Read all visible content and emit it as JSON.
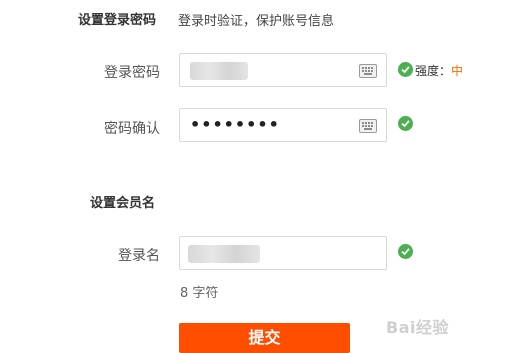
{
  "password_section": {
    "title": "设置登录密码",
    "hint": "登录时验证，保护账号信息"
  },
  "fields": {
    "password": {
      "label": "登录密码",
      "value": "",
      "strength_label": "强度：",
      "strength_value": "中"
    },
    "confirm": {
      "label": "密码确认",
      "value": "••••••••"
    }
  },
  "member_section": {
    "title": "设置会员名"
  },
  "username": {
    "label": "登录名",
    "value": "",
    "counter": "8 字符"
  },
  "submit": {
    "label": "提交"
  },
  "watermark": {
    "text": "Bai经验"
  },
  "colors": {
    "accent": "#ff4e00",
    "success": "#4caf50",
    "strength": "#ff6a00"
  }
}
